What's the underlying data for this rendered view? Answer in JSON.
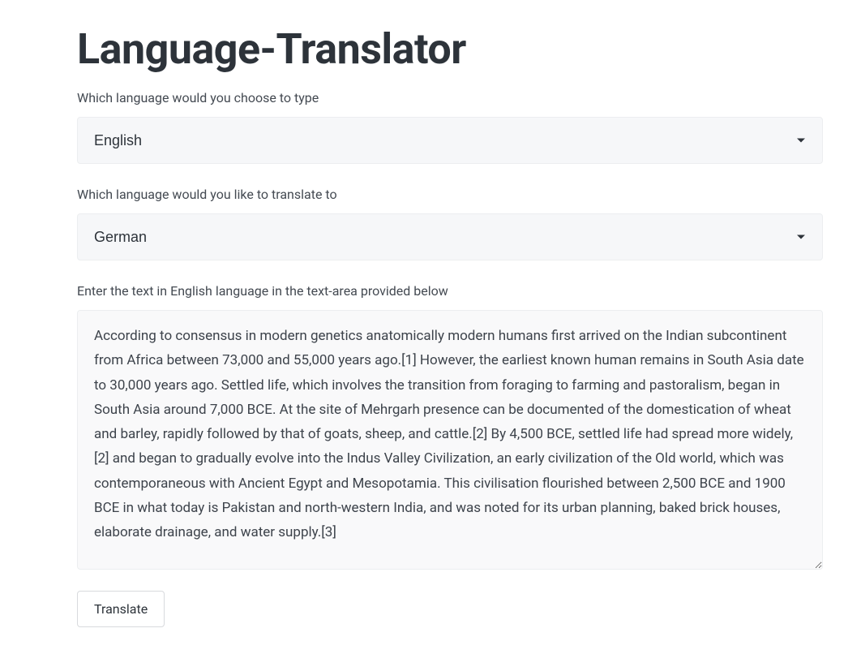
{
  "title": "Language-Translator",
  "source_label": "Which language would you choose to type",
  "source_value": "English",
  "target_label": "Which language would you like to translate to",
  "target_value": "German",
  "textarea_label": "Enter the text in English language in the text-area provided below",
  "textarea_value": "According to consensus in modern genetics anatomically modern humans first arrived on the Indian subcontinent from Africa between 73,000 and 55,000 years ago.[1] However, the earliest known human remains in South Asia date to 30,000 years ago. Settled life, which involves the transition from foraging to farming and pastoralism, began in South Asia around 7,000 BCE. At the site of Mehrgarh presence can be documented of the domestication of wheat and barley, rapidly followed by that of goats, sheep, and cattle.[2] By 4,500 BCE, settled life had spread more widely,[2] and began to gradually evolve into the Indus Valley Civilization, an early civilization of the Old world, which was contemporaneous with Ancient Egypt and Mesopotamia. This civilisation flourished between 2,500 BCE and 1900 BCE in what today is Pakistan and north-western India, and was noted for its urban planning, baked brick houses, elaborate drainage, and water supply.[3]",
  "translate_button": "Translate"
}
